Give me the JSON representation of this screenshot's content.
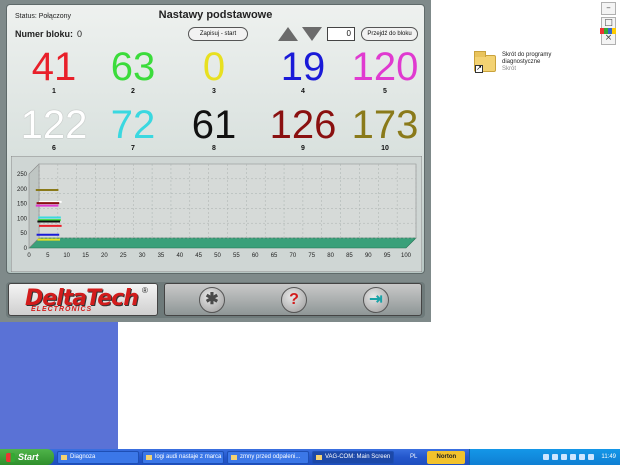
{
  "app": {
    "status": "Status: Połączony",
    "title": "Nastawy podstawowe",
    "block_label": "Numer bloku:",
    "block_value": "0",
    "save_button": "Zapisuj - start",
    "block_input": "0",
    "goto_button": "Przejdź do bloku",
    "fields": [
      {
        "value": "41",
        "index": "1",
        "color": "#e8202a"
      },
      {
        "value": "63",
        "index": "2",
        "color": "#3bdc3b"
      },
      {
        "value": "0",
        "index": "3",
        "color": "#e8e020"
      },
      {
        "value": "19",
        "index": "4",
        "color": "#1a1ad8"
      },
      {
        "value": "120",
        "index": "5",
        "color": "#e03ad0"
      },
      {
        "value": "122",
        "index": "6",
        "color": "#ffffff"
      },
      {
        "value": "72",
        "index": "7",
        "color": "#3ad8e0"
      },
      {
        "value": "61",
        "index": "8",
        "color": "#111111"
      },
      {
        "value": "126",
        "index": "9",
        "color": "#8a1010"
      },
      {
        "value": "173",
        "index": "10",
        "color": "#8a7a1a"
      }
    ],
    "logo_main": "DeltaTech",
    "logo_reg": "®",
    "logo_sub": "ELECTRONICS",
    "tools_glyph": "✱",
    "help_glyph": "?",
    "exit_glyph": "⇥"
  },
  "chart_data": {
    "type": "line",
    "x_ticks": [
      "0",
      "5",
      "10",
      "15",
      "20",
      "25",
      "30",
      "35",
      "40",
      "45",
      "50",
      "55",
      "60",
      "65",
      "70",
      "75",
      "80",
      "85",
      "90",
      "95",
      "100"
    ],
    "y_ticks": [
      "0",
      "50",
      "100",
      "150",
      "200",
      "250"
    ],
    "ylim": [
      0,
      250
    ],
    "xlim": [
      0,
      100
    ],
    "grid": true,
    "series": [
      {
        "values": [
          41,
          41,
          41,
          41
        ],
        "color": "#e8202a"
      },
      {
        "values": [
          63,
          63,
          63,
          63
        ],
        "color": "#3bdc3b"
      },
      {
        "values": [
          0,
          0,
          0,
          0
        ],
        "color": "#e8e020"
      },
      {
        "values": [
          19,
          19,
          19,
          19
        ],
        "color": "#1a1ad8"
      },
      {
        "values": [
          120,
          120,
          120,
          120
        ],
        "color": "#e03ad0"
      },
      {
        "values": [
          122,
          122,
          122,
          122
        ],
        "color": "#ffffff"
      },
      {
        "values": [
          72,
          72,
          72,
          72
        ],
        "color": "#3ad8e0"
      },
      {
        "values": [
          61,
          61,
          61,
          61
        ],
        "color": "#111111"
      },
      {
        "values": [
          126,
          126,
          126,
          126
        ],
        "color": "#8a1010"
      },
      {
        "values": [
          173,
          173,
          173,
          173
        ],
        "color": "#8a7a1a"
      }
    ],
    "x": [
      0,
      2,
      4,
      6
    ]
  },
  "desktop": {
    "icon_label": "Skrót do programy diagnostyczne",
    "icon_sub": "Skrót"
  },
  "taskbar": {
    "start": "Start",
    "tasks": [
      "Diagnoza",
      "logi audi nastaje z marca",
      "zmny przed odpaleni...",
      "VAG-COM: Main Screen"
    ],
    "lang": "PL",
    "norton": "Norton",
    "clock": "11:49"
  }
}
